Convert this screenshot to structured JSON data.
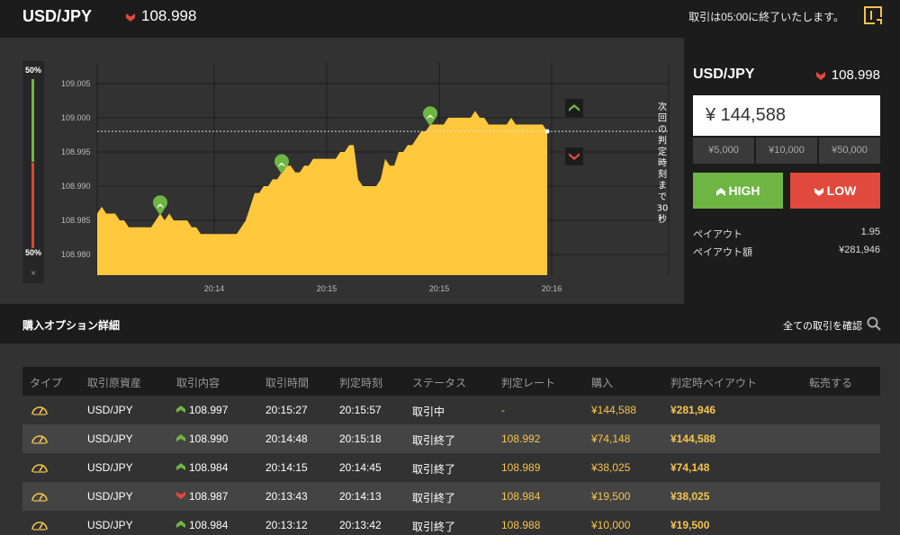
{
  "topbar": {
    "pair": "USD/JPY",
    "rate": "108.998",
    "notice": "取引は05:00に終了いたします。",
    "menu_icon": "sidebar-toggle-icon"
  },
  "sentiment": {
    "up": "50%",
    "down": "50%",
    "close": "×"
  },
  "chart_data": {
    "type": "area",
    "y_ticks": [
      "109.005",
      "109.000",
      "108.995",
      "108.990",
      "108.985",
      "108.980"
    ],
    "x_ticks": [
      "20:14",
      "20:15",
      "20:15",
      "20:16"
    ],
    "ylim": [
      108.977,
      109.008
    ],
    "xlim": [
      0,
      100
    ],
    "area_color": "#ffc83d",
    "x": [
      0,
      1,
      2,
      3,
      4,
      5,
      6,
      7,
      8,
      9,
      10,
      11,
      12,
      13,
      14,
      15,
      16,
      17,
      18,
      19,
      20,
      21,
      22,
      23,
      24,
      25,
      26,
      27,
      28,
      29,
      30,
      31,
      32,
      33,
      34,
      35,
      36,
      37,
      38,
      39,
      40,
      41,
      42,
      43,
      44,
      45,
      46,
      47,
      48,
      49,
      50,
      51,
      52,
      53,
      54,
      55,
      56,
      57,
      58,
      59,
      60,
      61,
      62,
      63,
      64,
      65,
      66,
      67,
      68,
      69,
      70,
      71,
      72,
      73,
      74,
      75,
      76,
      77,
      78,
      79,
      80,
      81,
      82,
      83,
      84,
      85,
      86,
      87,
      88,
      89,
      90,
      91,
      92,
      93,
      94,
      95,
      96,
      97,
      98,
      99,
      100
    ],
    "y": [
      108.986,
      108.987,
      108.986,
      108.986,
      108.986,
      108.985,
      108.985,
      108.984,
      108.984,
      108.984,
      108.984,
      108.984,
      108.984,
      108.985,
      108.986,
      108.985,
      108.986,
      108.985,
      108.985,
      108.985,
      108.985,
      108.984,
      108.984,
      108.983,
      108.983,
      108.983,
      108.983,
      108.983,
      108.983,
      108.983,
      108.983,
      108.983,
      108.984,
      108.985,
      108.987,
      108.989,
      108.989,
      108.99,
      108.99,
      108.991,
      108.991,
      108.992,
      108.993,
      108.993,
      108.992,
      108.992,
      108.993,
      108.993,
      108.994,
      108.994,
      108.994,
      108.994,
      108.994,
      108.994,
      108.995,
      108.995,
      108.996,
      108.996,
      108.991,
      108.99,
      108.99,
      108.99,
      108.99,
      108.991,
      108.994,
      108.993,
      108.993,
      108.995,
      108.995,
      108.996,
      108.996,
      108.997,
      108.998,
      108.998,
      108.999,
      108.999,
      108.999,
      108.999,
      109.0,
      109.0,
      109.0,
      109.0,
      109.0,
      109.0,
      109.001,
      109.0,
      109.0,
      108.999,
      108.999,
      108.999,
      108.999,
      108.999,
      109.0,
      108.999,
      108.999,
      108.999,
      108.999,
      108.999,
      108.999,
      108.999,
      108.998
    ],
    "markers": [
      {
        "x": 14,
        "y": 108.986,
        "dir": "up"
      },
      {
        "x": 41,
        "y": 108.992,
        "dir": "up"
      },
      {
        "x": 74,
        "y": 108.999,
        "dir": "up"
      }
    ],
    "current_rate": 108.998,
    "countdown_label": "次回の判定時刻まで30秒"
  },
  "trade": {
    "pair": "USD/JPY",
    "rate": "108.998",
    "amount": "¥ 144,588",
    "presets": [
      "¥5,000",
      "¥10,000",
      "¥50,000"
    ],
    "high_label": "HIGH",
    "low_label": "LOW",
    "payout_label": "ペイアウト",
    "payout_value": "1.95",
    "payout_amount_label": "ペイアウト額",
    "payout_amount_value": "¥281,946"
  },
  "details": {
    "title": "購入オプション詳細",
    "link": "全ての取引を確認"
  },
  "table": {
    "headers": [
      "タイプ",
      "取引原資産",
      "取引内容",
      "取引時間",
      "判定時刻",
      "ステータス",
      "判定レート",
      "購入",
      "判定時ペイアウト",
      "転売する"
    ],
    "rows": [
      {
        "asset": "USD/JPY",
        "dir": "up",
        "rate": "108.997",
        "time": "20:15:27",
        "judge": "20:15:57",
        "status": "取引中",
        "judge_rate": "-",
        "purchase": "¥144,588",
        "payout": "¥281,946"
      },
      {
        "asset": "USD/JPY",
        "dir": "up",
        "rate": "108.990",
        "time": "20:14:48",
        "judge": "20:15:18",
        "status": "取引終了",
        "judge_rate": "108.992",
        "purchase": "¥74,148",
        "payout": "¥144,588"
      },
      {
        "asset": "USD/JPY",
        "dir": "up",
        "rate": "108.984",
        "time": "20:14:15",
        "judge": "20:14:45",
        "status": "取引終了",
        "judge_rate": "108.989",
        "purchase": "¥38,025",
        "payout": "¥74,148"
      },
      {
        "asset": "USD/JPY",
        "dir": "down",
        "rate": "108.987",
        "time": "20:13:43",
        "judge": "20:14:13",
        "status": "取引終了",
        "judge_rate": "108.984",
        "purchase": "¥19,500",
        "payout": "¥38,025"
      },
      {
        "asset": "USD/JPY",
        "dir": "up",
        "rate": "108.984",
        "time": "20:13:12",
        "judge": "20:13:42",
        "status": "取引終了",
        "judge_rate": "108.988",
        "purchase": "¥10,000",
        "payout": "¥19,500"
      }
    ]
  },
  "colors": {
    "up": "#6fb544",
    "down": "#e0493b",
    "accent": "#f5c44d"
  }
}
